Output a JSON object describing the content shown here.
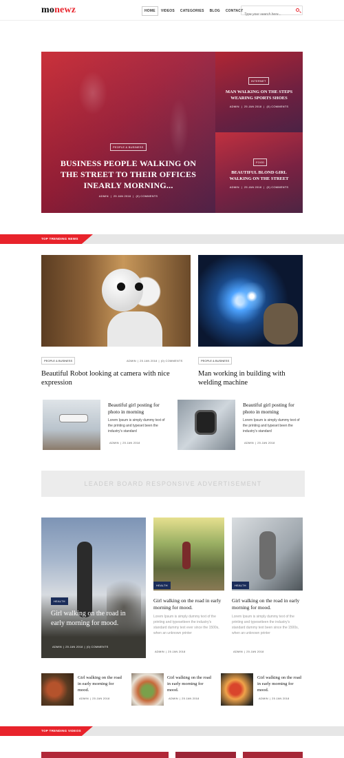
{
  "brand": {
    "logo_part1": "mo",
    "logo_part2": "newz",
    "accent": "#e8232b"
  },
  "nav": {
    "items": [
      "HOME",
      "VIDEOS",
      "CATEGORIES",
      "BLOG",
      "CONTACT"
    ],
    "active": "HOME"
  },
  "search": {
    "placeholder": "Type your search here...",
    "icon": "search-icon"
  },
  "hero": {
    "main": {
      "tag": "PEOPLE & BUSINESS",
      "title": "BUSINESS PEOPLE WALKING ON THE STREET TO THEIR OFFICES INEARLY MORNING...",
      "author": "ADMIN",
      "date": "25 JAN 2018",
      "comments": "(0) COMMENTS"
    },
    "side1": {
      "tag": "INTERNET",
      "title": "MAN WALKING ON THE STEPS WEARING SPORTS SHOES",
      "author": "ADMIN",
      "date": "25 JAN 2018",
      "comments": "(0) COMMENTS"
    },
    "side2": {
      "tag": "FOOD",
      "title": "BEAUTIFUL BLOND GIRL WALKING ON THE STREET",
      "author": "ADMIN",
      "date": "25 JAN 2018",
      "comments": "(0) COMMENTS"
    }
  },
  "trending_news": {
    "heading": "TOP TRENDING NEWS",
    "feature1": {
      "tag": "PEOPLE & BUSINESS",
      "author": "ADMIN",
      "date": "25 JAN 2018",
      "comments": "(0) COMMENTS",
      "title": "Beautiful Robot looking at camera with nice expression"
    },
    "feature2": {
      "tag": "PEOPLE & BUSINESS",
      "title": "Man working in building with welding machine"
    },
    "small1": {
      "title": "Beautiful girl posting for photo in morning",
      "excerpt": "Lorem Ipsum is simply dummy text of the printing and typeset been the industry's standard",
      "author": "ADMIN",
      "date": "25 JAN 2018"
    },
    "small2": {
      "title": "Beautiful girl posting for photo in morning",
      "excerpt": "Lorem Ipsum is simply dummy text of the printing and typeset been the industry's standard",
      "author": "ADMIN",
      "date": "25 JAN 2018"
    }
  },
  "ad": {
    "text": "LEADER BOARD RESPONSIVE ADVERTISEMENT"
  },
  "health": {
    "big": {
      "tag": "HEALTH",
      "title": "Girl walking on the road in early morning for mood.",
      "author": "ADMIN",
      "date": "25 JAN 2018",
      "comments": "(0) COMMENTS"
    },
    "card1": {
      "tag": "HEALTH",
      "title": "Girl walking on the road in early morning for mood.",
      "excerpt": "Lorem Ipsum is simply dummy text of the printing and typesetteen the industry's standard dummy text ever since the 1500s, when an unknown printer",
      "author": "ADMIN",
      "date": "25 JAN 2018"
    },
    "card2": {
      "tag": "HEALTH",
      "title": "Girl walking on the road in early morning for mood.",
      "excerpt": "Lorem Ipsum is simply dummy text of the printing and typesetteen the industry's standard dummy text been since the 1500s, when an unknown printer",
      "author": "ADMIN",
      "date": "25 JAN 2018"
    },
    "mini": [
      {
        "title": "Girl walking on the road in early morning for mood.",
        "author": "ADMIN",
        "date": "25 JAN 2018"
      },
      {
        "title": "Girl walking on the road in early morning for mood.",
        "author": "ADMIN",
        "date": "25 JAN 2018"
      },
      {
        "title": "Girl walking on the road in early morning for mood.",
        "author": "ADMIN",
        "date": "25 JAN 2018"
      }
    ]
  },
  "trending_videos": {
    "heading": "TOP TRENDING VIDEOS"
  }
}
